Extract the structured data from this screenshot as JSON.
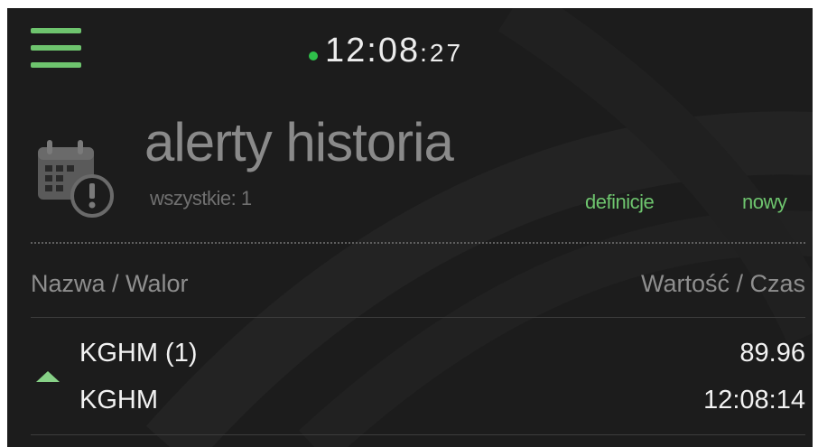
{
  "header": {
    "menu_icon": "hamburger-icon",
    "status_indicator_color": "#2fbf4a",
    "clock_hhmm": "12:08",
    "clock_seconds": ":27"
  },
  "page": {
    "icon": "calendar-alert-icon",
    "title": "alerty historia",
    "subtitle": "wszystkie: 1",
    "links": {
      "definitions": "definicje",
      "new": "nowy"
    }
  },
  "table": {
    "columns": {
      "name": "Nazwa / Walor",
      "value": "Wartość / Czas"
    },
    "rows": [
      {
        "trend": "up",
        "trend_icon": "triangle-up-icon",
        "name": "KGHM (1)",
        "ticker": "KGHM",
        "value": "89.96",
        "time": "12:08:14"
      }
    ]
  },
  "colors": {
    "accent": "#6ec46e",
    "background": "#1c1c1c",
    "trend_up": "#87d187"
  }
}
